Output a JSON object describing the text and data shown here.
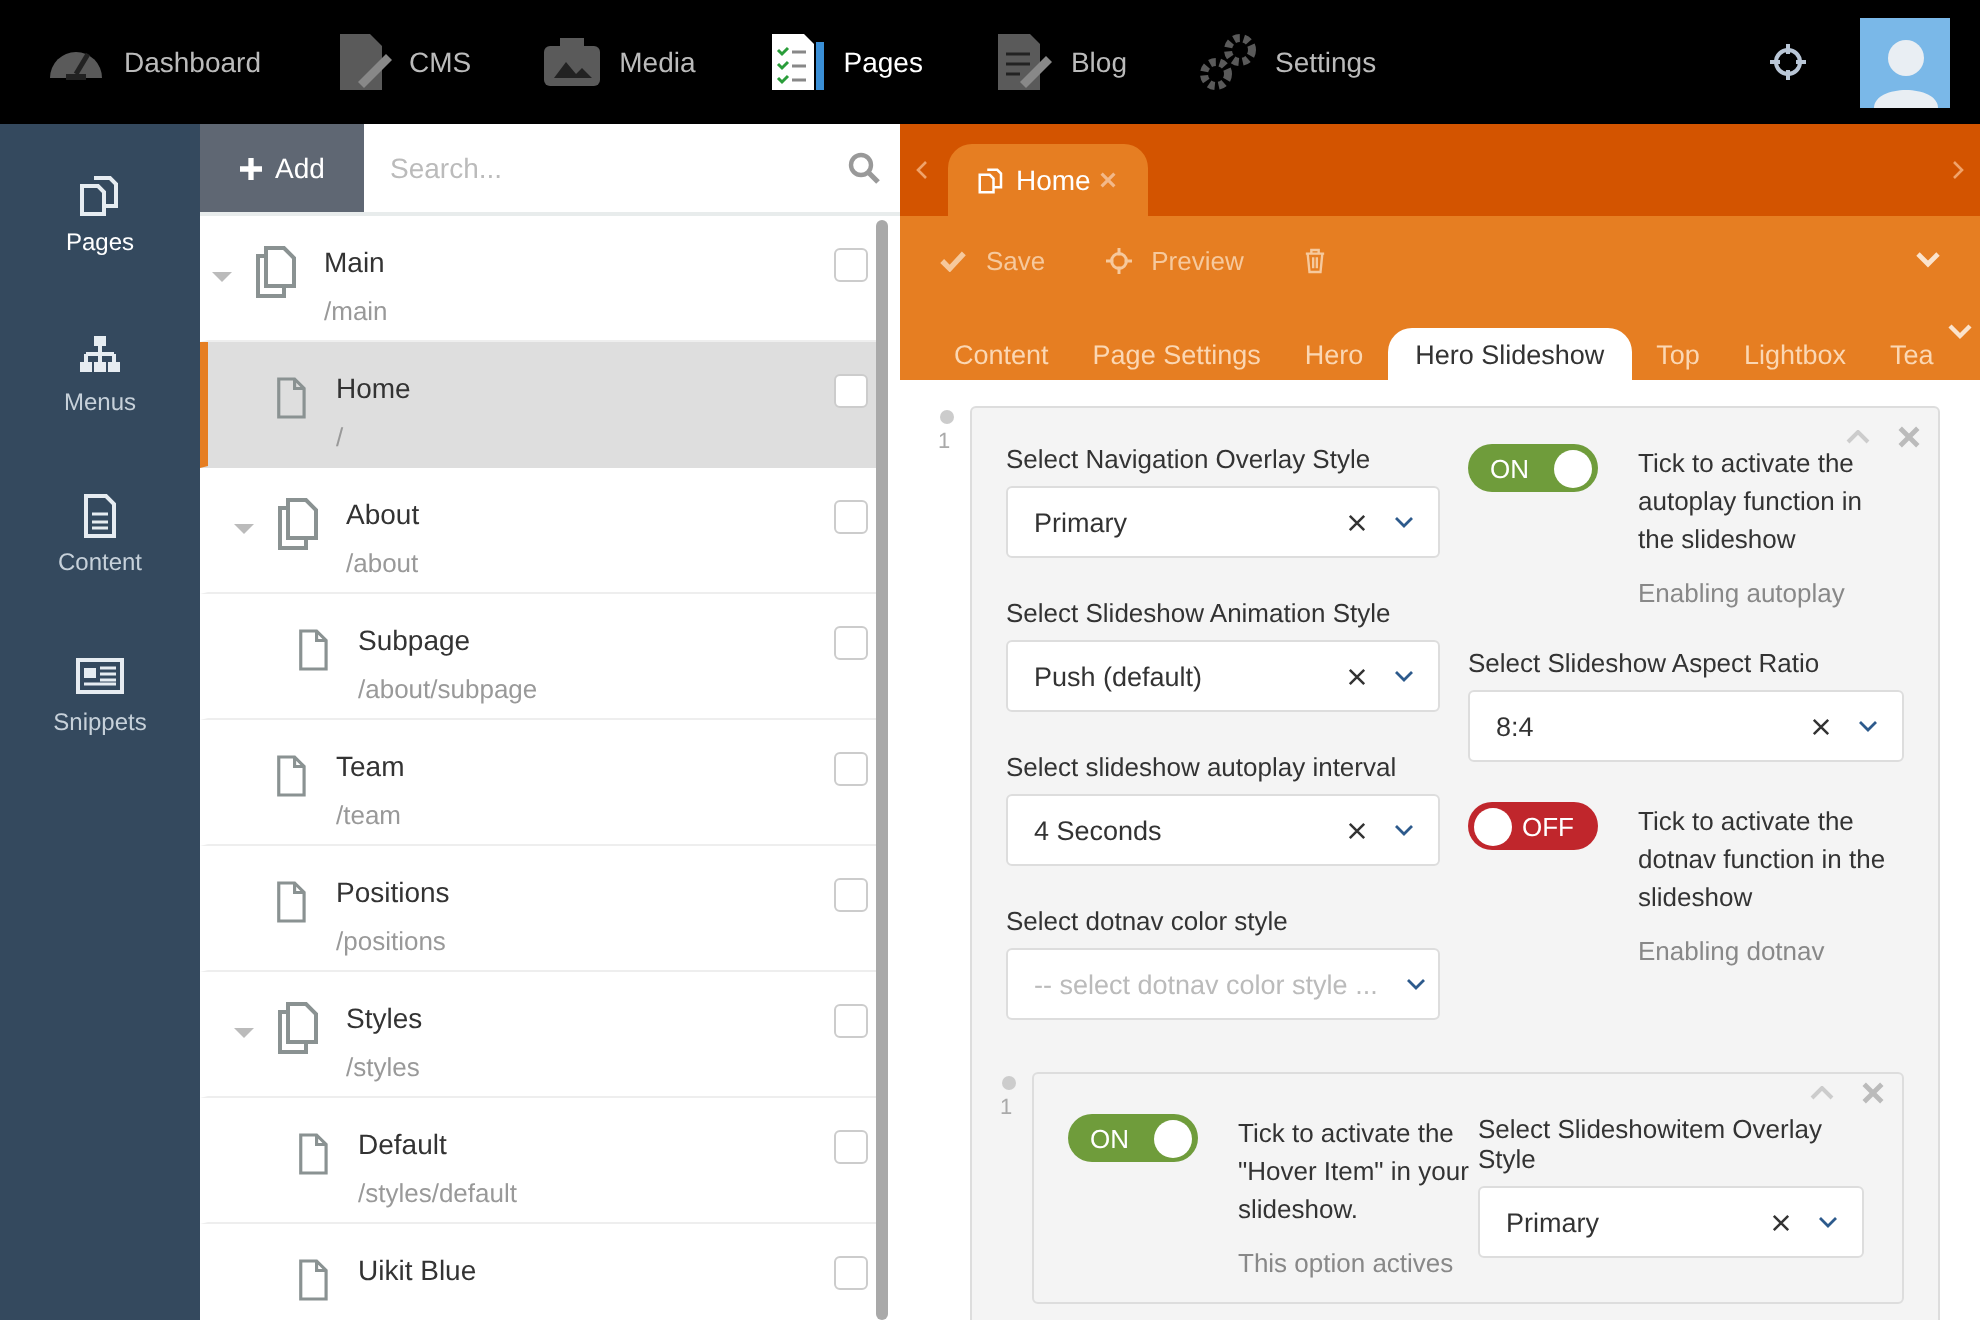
{
  "topbar": {
    "nav": [
      {
        "label": "Dashboard",
        "selected": false
      },
      {
        "label": "CMS",
        "selected": false
      },
      {
        "label": "Media",
        "selected": false
      },
      {
        "label": "Pages",
        "selected": true
      },
      {
        "label": "Blog",
        "selected": false
      },
      {
        "label": "Settings",
        "selected": false
      }
    ]
  },
  "sidebar": {
    "items": [
      {
        "label": "Pages",
        "selected": true
      },
      {
        "label": "Menus",
        "selected": false
      },
      {
        "label": "Content",
        "selected": false
      },
      {
        "label": "Snippets",
        "selected": false
      }
    ]
  },
  "tree": {
    "add_button": "Add",
    "search": {
      "placeholder": "Search..."
    },
    "items": [
      {
        "title": "Main",
        "path": "/main",
        "expanded": true,
        "selected": false,
        "checked": false,
        "children": [
          {
            "title": "Home",
            "path": "/",
            "selected": true,
            "checked": false
          },
          {
            "title": "About",
            "path": "/about",
            "expanded": true,
            "selected": false,
            "checked": false,
            "children": [
              {
                "title": "Subpage",
                "path": "/about/subpage",
                "selected": false,
                "checked": false
              }
            ]
          },
          {
            "title": "Team",
            "path": "/team",
            "selected": false,
            "checked": false
          },
          {
            "title": "Positions",
            "path": "/positions",
            "selected": false,
            "checked": false
          },
          {
            "title": "Styles",
            "path": "/styles",
            "expanded": true,
            "selected": false,
            "checked": false,
            "children": [
              {
                "title": "Default",
                "path": "/styles/default",
                "selected": false,
                "checked": false
              },
              {
                "title": "Uikit Blue",
                "selected": false,
                "checked": false
              }
            ]
          }
        ]
      }
    ]
  },
  "editor": {
    "open_tabs": [
      {
        "label": "Home",
        "selected": true
      }
    ],
    "actions": [
      "Save",
      "Preview"
    ],
    "section_tabs": [
      {
        "label": "Content",
        "selected": false
      },
      {
        "label": "Page Settings",
        "selected": false
      },
      {
        "label": "Hero",
        "selected": false
      },
      {
        "label": "Hero Slideshow",
        "selected": true
      },
      {
        "label": "Top",
        "selected": false
      },
      {
        "label": "Lightbox",
        "selected": false
      },
      {
        "label": "Tea",
        "selected": false
      }
    ],
    "item": {
      "index": "1",
      "left": [
        {
          "kind": "select",
          "label": "Select Navigation Overlay Style",
          "value": "Primary"
        },
        {
          "kind": "select",
          "label": "Select Slideshow Animation Style",
          "value": "Push (default)"
        },
        {
          "kind": "select",
          "label": "Select slideshow autoplay interval",
          "value": "4 Seconds"
        },
        {
          "kind": "select",
          "label": "Select dotnav color style",
          "placeholder": "-- select dotnav color style ..."
        }
      ],
      "right": [
        {
          "kind": "toggle",
          "on": true,
          "state_text": "ON",
          "description": "Tick to activate the autoplay function in the slideshow",
          "help": "Enabling autoplay"
        },
        {
          "kind": "select",
          "label": "Select Slideshow Aspect Ratio",
          "value": "8:4"
        },
        {
          "kind": "toggle",
          "on": false,
          "state_text": "OFF",
          "description": "Tick to activate the dotnav function in the slideshow",
          "help": "Enabling dotnav"
        }
      ],
      "subitems": [
        {
          "index": "1",
          "fields": [
            {
              "kind": "toggle",
              "on": true,
              "state_text": "ON",
              "description": "Tick to activate the \"Hover Item\" in your slideshow.",
              "help": "This option actives"
            },
            {
              "kind": "select",
              "label": "Select Slideshowitem Overlay Style",
              "value": "Primary"
            }
          ]
        }
      ]
    }
  }
}
